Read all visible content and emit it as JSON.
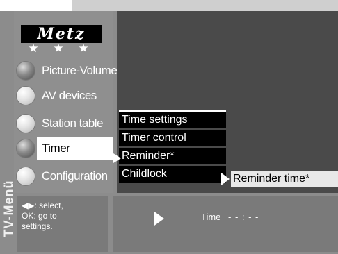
{
  "brand": {
    "logo": "Metz",
    "stars": "★ ★ ★"
  },
  "side_label": "TV-Menü",
  "menu": {
    "items": [
      {
        "label": "Picture-Volume"
      },
      {
        "label": "AV devices"
      },
      {
        "label": "Station table"
      },
      {
        "label": "Timer"
      },
      {
        "label": "Configuration"
      }
    ],
    "selected": "Timer"
  },
  "submenu": {
    "items": [
      {
        "label": "Time settings"
      },
      {
        "label": "Timer control"
      },
      {
        "label": "Reminder*"
      },
      {
        "label": "Childlock"
      }
    ],
    "selected": "Reminder*"
  },
  "reminder_option": {
    "label": "Reminder time*"
  },
  "help": {
    "line1": "◀▶: select,",
    "line2": "OK: go to",
    "line3": "settings."
  },
  "status": {
    "time_label": "Time",
    "time_value": "- - : - -"
  },
  "colors": {
    "background": "#8c8c8c",
    "screen": "#4a4a4a",
    "option_bg": "#000000",
    "highlight": "#ffffff"
  }
}
